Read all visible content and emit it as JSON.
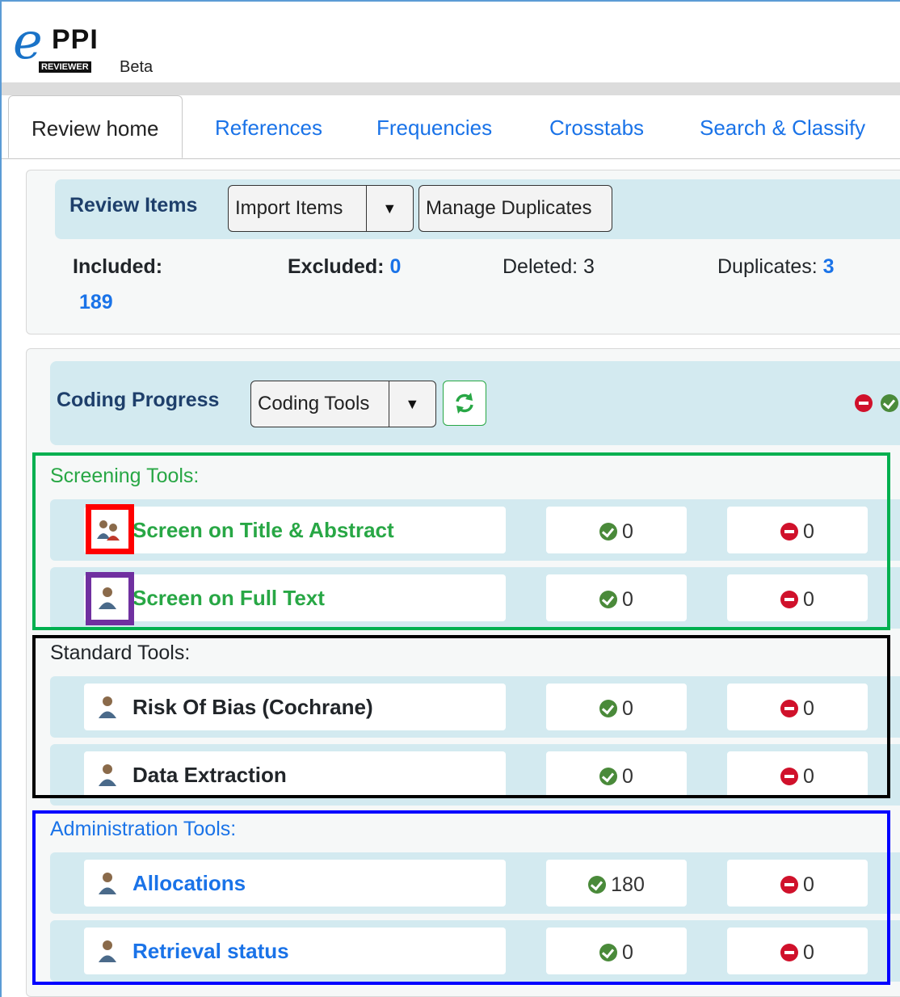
{
  "logo": {
    "letter": "e",
    "name": "PPI",
    "sub": "REVIEWER",
    "badge": "Beta"
  },
  "tabs": [
    "Review home",
    "References",
    "Frequencies",
    "Crosstabs",
    "Search & Classify"
  ],
  "review_items": {
    "title": "Review Items",
    "import_label": "Import Items",
    "caret": "▼",
    "manage_label": "Manage Duplicates",
    "included_label": "Included:",
    "included_value": "189",
    "excluded_label": "Excluded:",
    "excluded_value": "0",
    "deleted_text": "Deleted: 3",
    "duplicates_label": "Duplicates:",
    "duplicates_value": "3"
  },
  "coding": {
    "title": "Coding Progress",
    "tools_label": "Coding Tools",
    "caret": "▼"
  },
  "sections": {
    "screening": "Screening Tools:",
    "standard": "Standard Tools:",
    "admin": "Administration Tools:"
  },
  "rows": [
    {
      "name": "Screen on Title & Abstract",
      "included": "0",
      "excluded": "0"
    },
    {
      "name": "Screen on Full Text",
      "included": "0",
      "excluded": "0"
    },
    {
      "name": "Risk Of Bias (Cochrane)",
      "included": "0",
      "excluded": "0"
    },
    {
      "name": "Data Extraction",
      "included": "0",
      "excluded": "0"
    },
    {
      "name": "Allocations",
      "included": "180",
      "excluded": "0"
    },
    {
      "name": "Retrieval status",
      "included": "0",
      "excluded": "0"
    }
  ],
  "colors": {
    "screening": "#28a745",
    "standard": "#212529",
    "admin": "#1a73e8",
    "highlight_red": "#ff0000",
    "highlight_purple": "#7030a0",
    "highlight_green": "#00b050",
    "highlight_black": "#000000",
    "highlight_blue": "#0000ff"
  }
}
